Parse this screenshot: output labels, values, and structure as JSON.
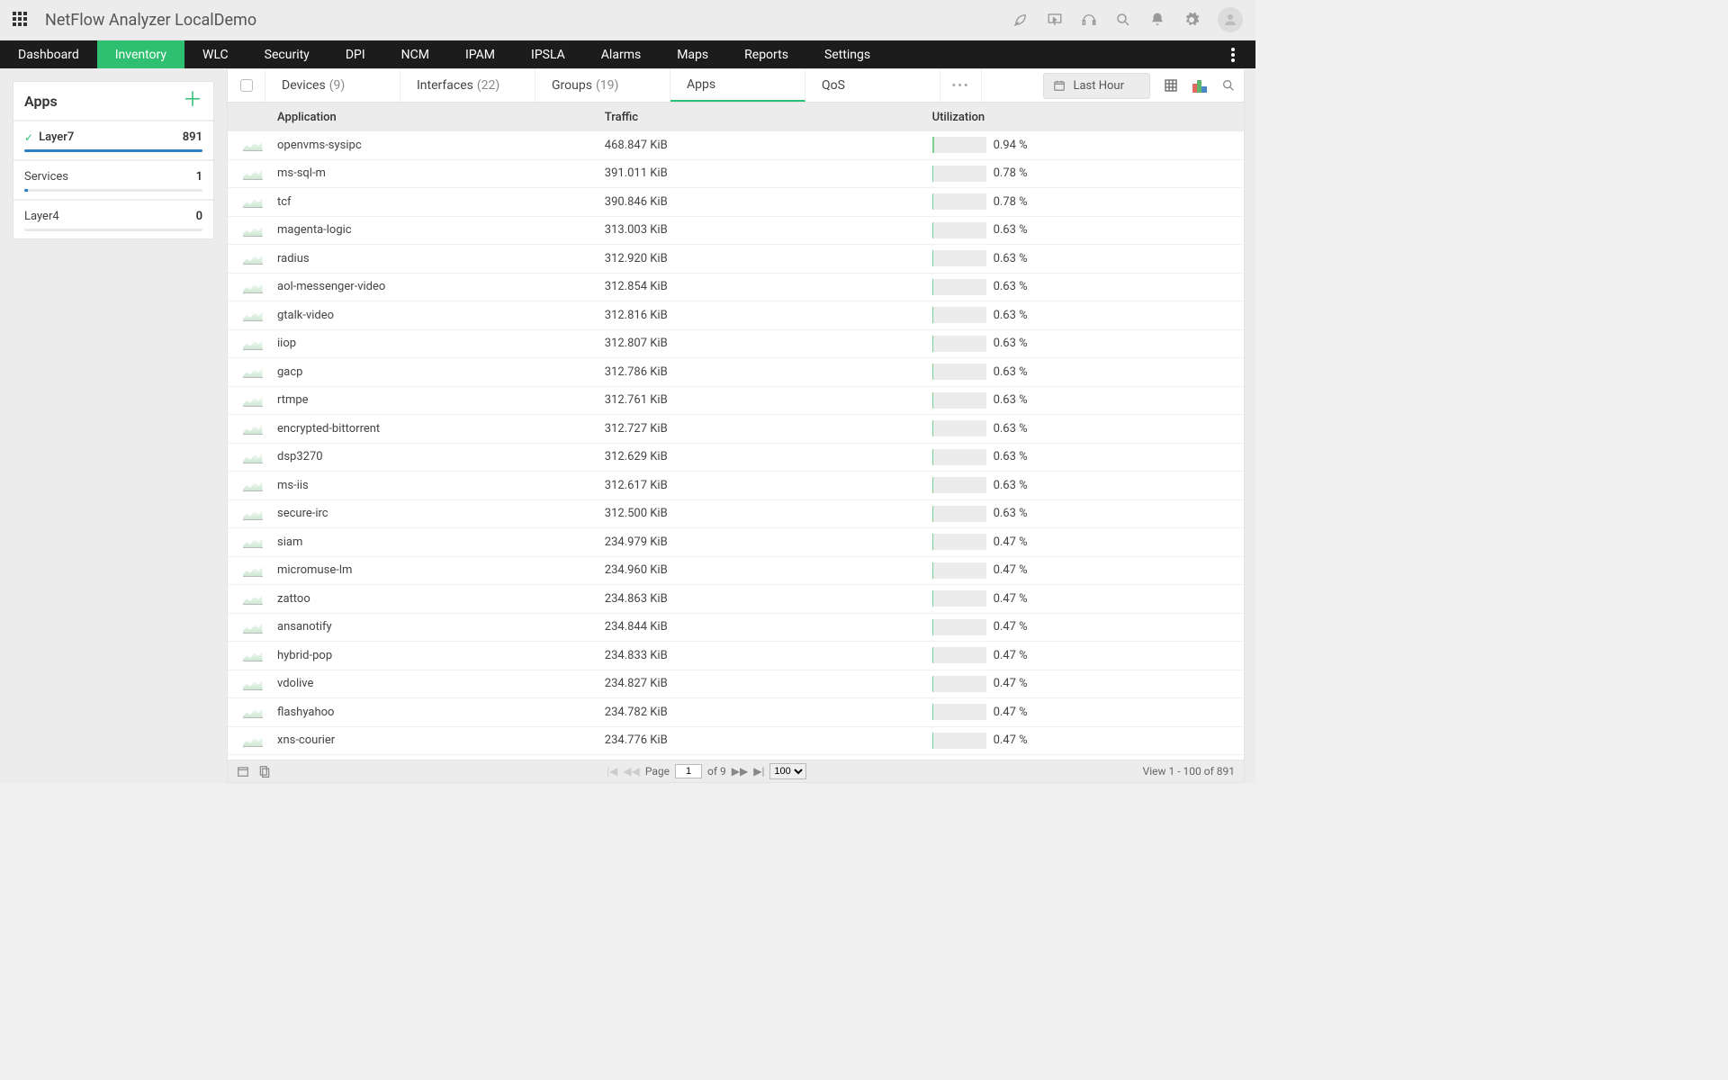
{
  "header": {
    "title": "NetFlow Analyzer LocalDemo"
  },
  "nav": {
    "items": [
      "Dashboard",
      "Inventory",
      "WLC",
      "Security",
      "DPI",
      "NCM",
      "IPAM",
      "IPSLA",
      "Alarms",
      "Maps",
      "Reports",
      "Settings"
    ],
    "active": "Inventory"
  },
  "sidebar": {
    "title": "Apps",
    "items": [
      {
        "label": "Layer7",
        "count": "891",
        "selected": true,
        "progress_pct": 100
      },
      {
        "label": "Services",
        "count": "1",
        "selected": false,
        "progress_pct": 2
      },
      {
        "label": "Layer4",
        "count": "0",
        "selected": false,
        "progress_pct": 0
      }
    ]
  },
  "subtabs": {
    "items": [
      {
        "label": "Devices",
        "count": "(9)"
      },
      {
        "label": "Interfaces",
        "count": "(22)"
      },
      {
        "label": "Groups",
        "count": "(19)"
      },
      {
        "label": "Apps",
        "count": ""
      },
      {
        "label": "QoS",
        "count": ""
      }
    ],
    "active": "Apps",
    "time_range": "Last Hour"
  },
  "columns": {
    "app": "Application",
    "traffic": "Traffic",
    "util": "Utilization"
  },
  "rows": [
    {
      "app": "openvms-sysipc",
      "traffic": "468.847 KiB",
      "util": "0.94 %",
      "util_w": 0.94
    },
    {
      "app": "ms-sql-m",
      "traffic": "391.011 KiB",
      "util": "0.78 %",
      "util_w": 0.78
    },
    {
      "app": "tcf",
      "traffic": "390.846 KiB",
      "util": "0.78 %",
      "util_w": 0.78
    },
    {
      "app": "magenta-logic",
      "traffic": "313.003 KiB",
      "util": "0.63 %",
      "util_w": 0.63
    },
    {
      "app": "radius",
      "traffic": "312.920 KiB",
      "util": "0.63 %",
      "util_w": 0.63
    },
    {
      "app": "aol-messenger-video",
      "traffic": "312.854 KiB",
      "util": "0.63 %",
      "util_w": 0.63
    },
    {
      "app": "gtalk-video",
      "traffic": "312.816 KiB",
      "util": "0.63 %",
      "util_w": 0.63
    },
    {
      "app": "iiop",
      "traffic": "312.807 KiB",
      "util": "0.63 %",
      "util_w": 0.63
    },
    {
      "app": "gacp",
      "traffic": "312.786 KiB",
      "util": "0.63 %",
      "util_w": 0.63
    },
    {
      "app": "rtmpe",
      "traffic": "312.761 KiB",
      "util": "0.63 %",
      "util_w": 0.63
    },
    {
      "app": "encrypted-bittorrent",
      "traffic": "312.727 KiB",
      "util": "0.63 %",
      "util_w": 0.63
    },
    {
      "app": "dsp3270",
      "traffic": "312.629 KiB",
      "util": "0.63 %",
      "util_w": 0.63
    },
    {
      "app": "ms-iis",
      "traffic": "312.617 KiB",
      "util": "0.63 %",
      "util_w": 0.63
    },
    {
      "app": "secure-irc",
      "traffic": "312.500 KiB",
      "util": "0.63 %",
      "util_w": 0.63
    },
    {
      "app": "siam",
      "traffic": "234.979 KiB",
      "util": "0.47 %",
      "util_w": 0.47
    },
    {
      "app": "micromuse-lm",
      "traffic": "234.960 KiB",
      "util": "0.47 %",
      "util_w": 0.47
    },
    {
      "app": "zattoo",
      "traffic": "234.863 KiB",
      "util": "0.47 %",
      "util_w": 0.47
    },
    {
      "app": "ansanotify",
      "traffic": "234.844 KiB",
      "util": "0.47 %",
      "util_w": 0.47
    },
    {
      "app": "hybrid-pop",
      "traffic": "234.833 KiB",
      "util": "0.47 %",
      "util_w": 0.47
    },
    {
      "app": "vdolive",
      "traffic": "234.827 KiB",
      "util": "0.47 %",
      "util_w": 0.47
    },
    {
      "app": "flashyahoo",
      "traffic": "234.782 KiB",
      "util": "0.47 %",
      "util_w": 0.47
    },
    {
      "app": "xns-courier",
      "traffic": "234.776 KiB",
      "util": "0.47 %",
      "util_w": 0.47
    }
  ],
  "footer": {
    "page_label": "Page",
    "page_current": "1",
    "page_of": "of 9",
    "page_size": "100",
    "view_text": "View 1 - 100 of 891"
  }
}
